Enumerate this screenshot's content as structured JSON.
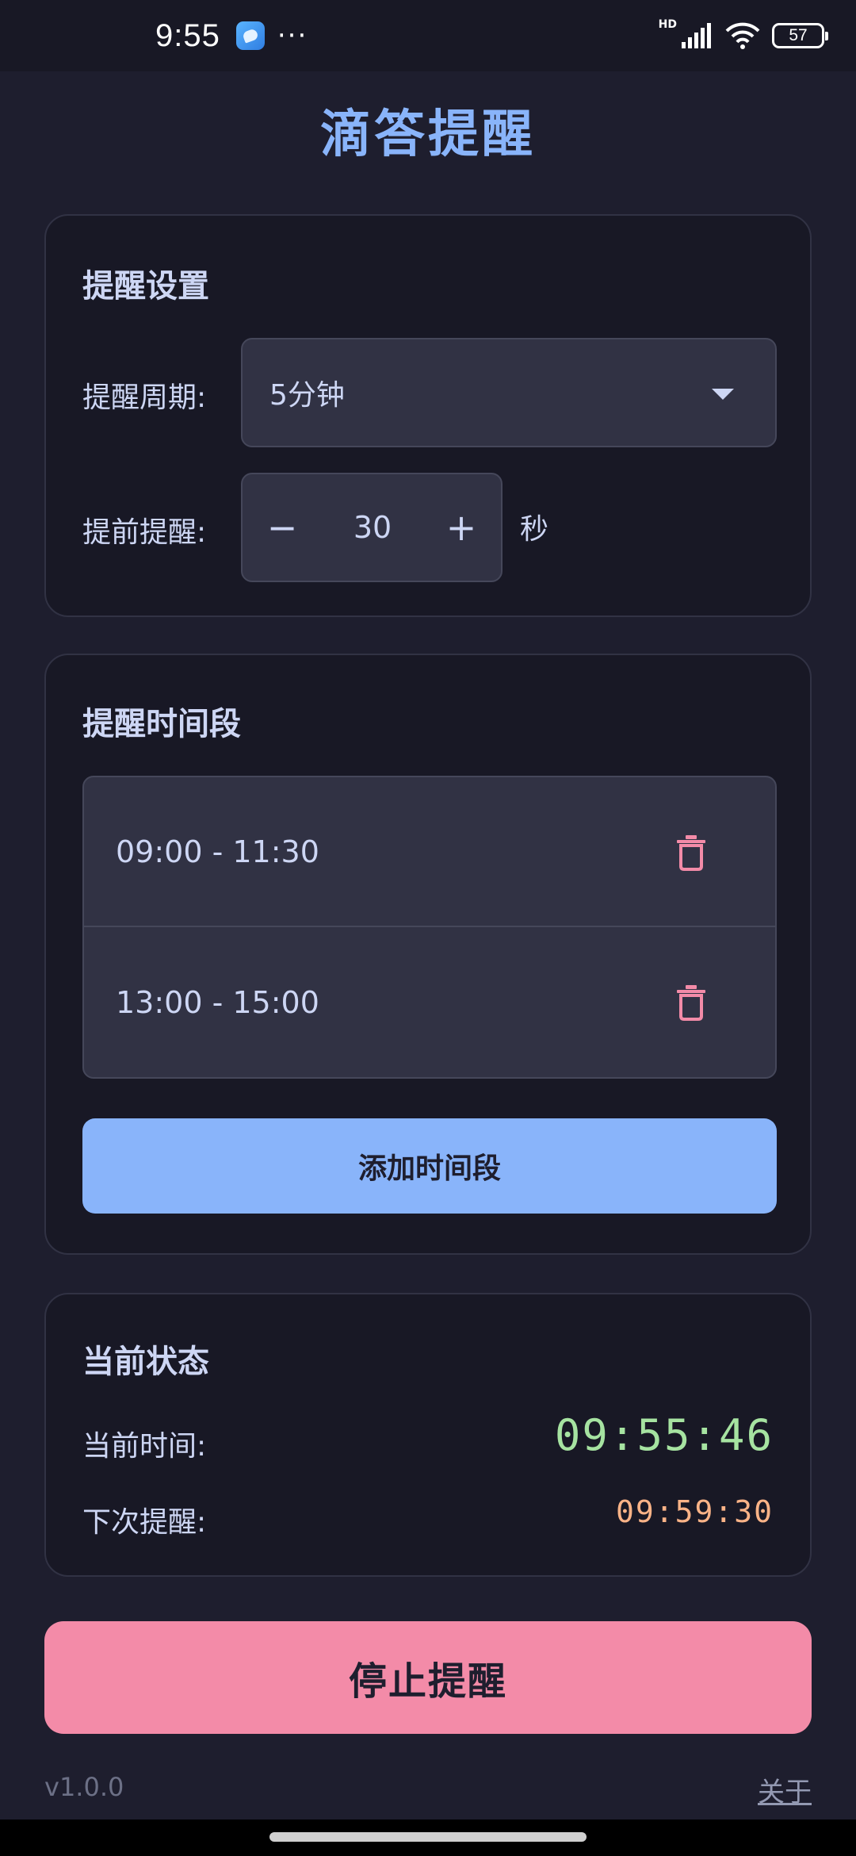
{
  "statusbar": {
    "time": "9:55",
    "dots": "···",
    "hd": "HD",
    "battery": "57"
  },
  "app": {
    "title": "滴答提醒"
  },
  "settings": {
    "title": "提醒设置",
    "period_label": "提醒周期:",
    "period_value": "5分钟",
    "advance_label": "提前提醒:",
    "advance_minus": "−",
    "advance_value": "30",
    "advance_plus": "+",
    "advance_unit": "秒"
  },
  "periods": {
    "title": "提醒时间段",
    "items": [
      {
        "range": "09:00 - 11:30"
      },
      {
        "range": "13:00 - 15:00"
      }
    ],
    "add_label": "添加时间段"
  },
  "status": {
    "title": "当前状态",
    "now_label": "当前时间:",
    "now_value": "09:55:46",
    "next_label": "下次提醒:",
    "next_value": "09:59:30"
  },
  "actions": {
    "stop_label": "停止提醒"
  },
  "footer": {
    "version": "v1.0.0",
    "about": "关于"
  },
  "colors": {
    "accent": "#89b4fa",
    "danger": "#f38ba8",
    "success": "#a6e3a1",
    "warning": "#fab387",
    "background": "#1e1e2e"
  }
}
